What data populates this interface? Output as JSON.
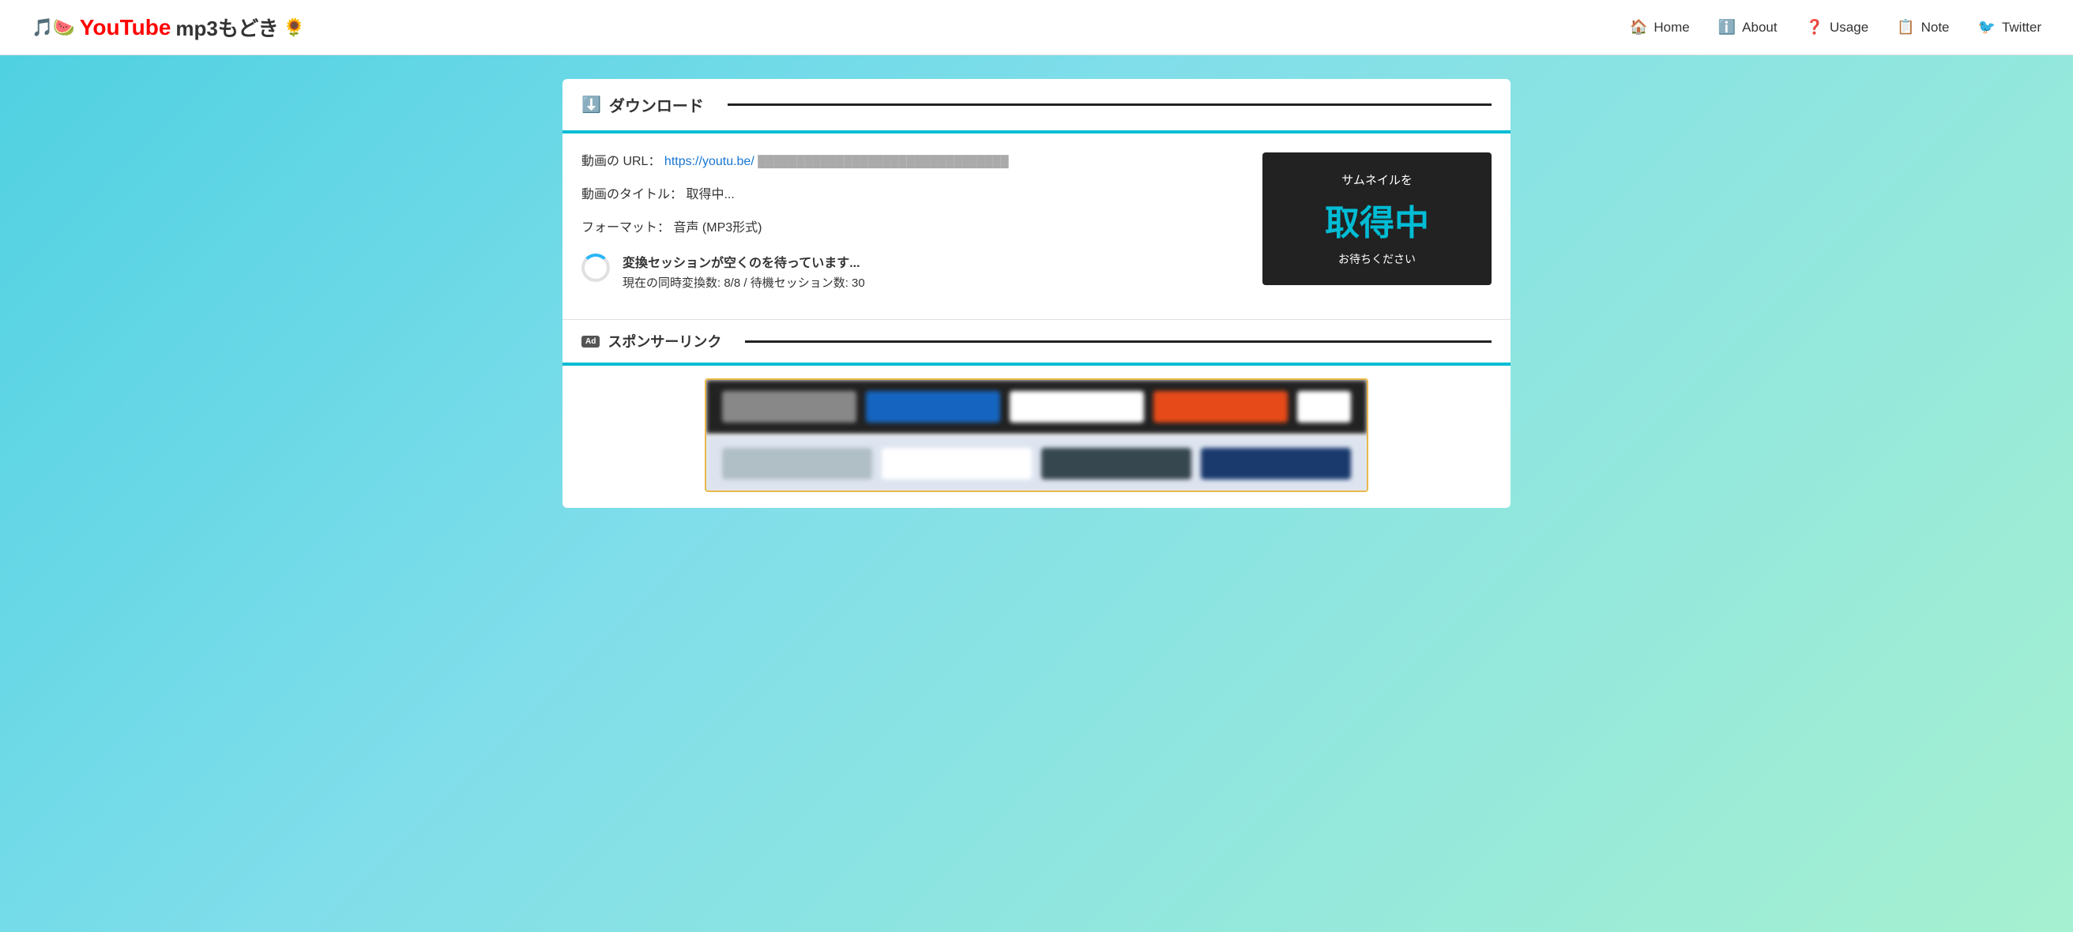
{
  "header": {
    "logo_text": "YouTube",
    "logo_sub": " mp3もどき",
    "nav": {
      "items": [
        {
          "label": "Home",
          "icon": "🏠",
          "name": "home"
        },
        {
          "label": "About",
          "icon": "ℹ️",
          "name": "about"
        },
        {
          "label": "Usage",
          "icon": "❓",
          "name": "usage"
        },
        {
          "label": "Note",
          "icon": "📋",
          "name": "note"
        },
        {
          "label": "Twitter",
          "icon": "🐦",
          "name": "twitter"
        }
      ]
    }
  },
  "download_section": {
    "title": "ダウンロード",
    "url_label": "動画の URL：",
    "url_value": "https://youtu.be/",
    "title_label": "動画のタイトル：",
    "title_value": "取得中...",
    "format_label": "フォーマット：",
    "format_value": "音声 (MP3形式)",
    "waiting_title": "変換セッションが空くのを待っています...",
    "waiting_detail": "現在の同時変換数: 8/8 / 待機セッション数: 30",
    "thumbnail": {
      "subtitle": "サムネイルを",
      "main": "取得中",
      "wait": "お待ちください"
    }
  },
  "sponsor_section": {
    "ad_badge": "Ad",
    "title": "スポンサーリンク"
  }
}
